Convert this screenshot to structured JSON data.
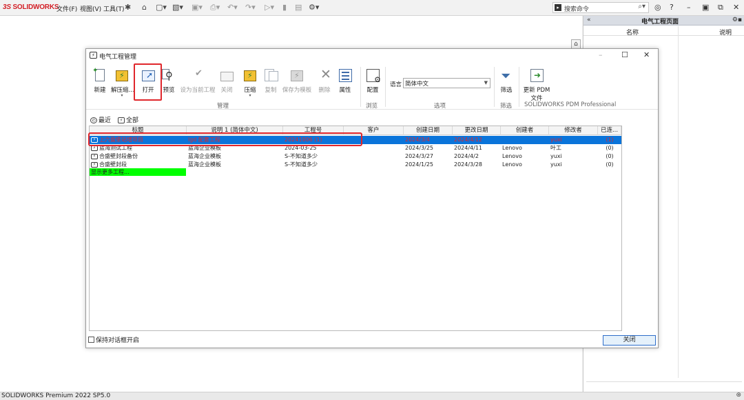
{
  "app": {
    "logo": "SOLIDWORKS",
    "menus": [
      "文件(F)",
      "视图(V)",
      "工具(T)"
    ],
    "search_placeholder": "搜索命令",
    "status": "SOLIDWORKS Premium 2022 SP5.0"
  },
  "taskpane": {
    "collapse": "«",
    "title": "电气工程页面",
    "col_name": "名称",
    "col_desc": "说明"
  },
  "dialog": {
    "title": "电气工程管理",
    "ribbon": {
      "new": "新建",
      "unzip": "解压缩...",
      "open": "打开",
      "preview": "预览",
      "set_current": "设为当前工程",
      "close": "关闭",
      "compress": "压缩",
      "copy": "复制",
      "save_template": "保存为模板",
      "delete": "删除",
      "properties": "属性",
      "config": "配置",
      "filter": "筛选",
      "update_pdm_1": "更新 PDM",
      "update_pdm_2": "文件",
      "group_manage": "管理",
      "group_browse": "浏览",
      "group_options": "选项",
      "group_filter": "筛选",
      "group_pdm": "SOLIDWORKS PDM Professional",
      "language_label": "语言",
      "language_value": "简体中文"
    },
    "tabs": {
      "recent": "最近",
      "all": "全部"
    },
    "columns": [
      "标题",
      "说明 1 (简体中文)",
      "工程号",
      "客户",
      "创建日期",
      "更改日期",
      "创建者",
      "修改者",
      "已连..."
    ],
    "rows": [
      {
        "title": "上六盈堡站增项目",
        "desc": "lgd 配套工程",
        "num": "20241006 (1)",
        "customer": "",
        "created": "2024/3/4",
        "changed": "2024/4/12",
        "creator": "",
        "modifier": "yuxi",
        "conn": "(1)"
      },
      {
        "title": "蓝海测试工程",
        "desc": "蓝海企业模板",
        "num": "2024-03-25",
        "customer": "",
        "created": "2024/3/25",
        "changed": "2024/4/11",
        "creator": "Lenovo",
        "modifier": "叶工",
        "conn": "(0)"
      },
      {
        "title": "合盛壁封段备份",
        "desc": "蓝海企业模板",
        "num": "S-不知道多少",
        "customer": "",
        "created": "2024/3/27",
        "changed": "2024/4/2",
        "creator": "Lenovo",
        "modifier": "yuxi",
        "conn": "(0)"
      },
      {
        "title": "合盛壁封段",
        "desc": "蓝海企业模板",
        "num": "S-不知道多少",
        "customer": "",
        "created": "2024/1/25",
        "changed": "2024/3/28",
        "creator": "Lenovo",
        "modifier": "yuxi",
        "conn": "(0)"
      }
    ],
    "more": "显示更多工程...",
    "keep_open": "保持对话框开启",
    "close_button": "关闭"
  }
}
